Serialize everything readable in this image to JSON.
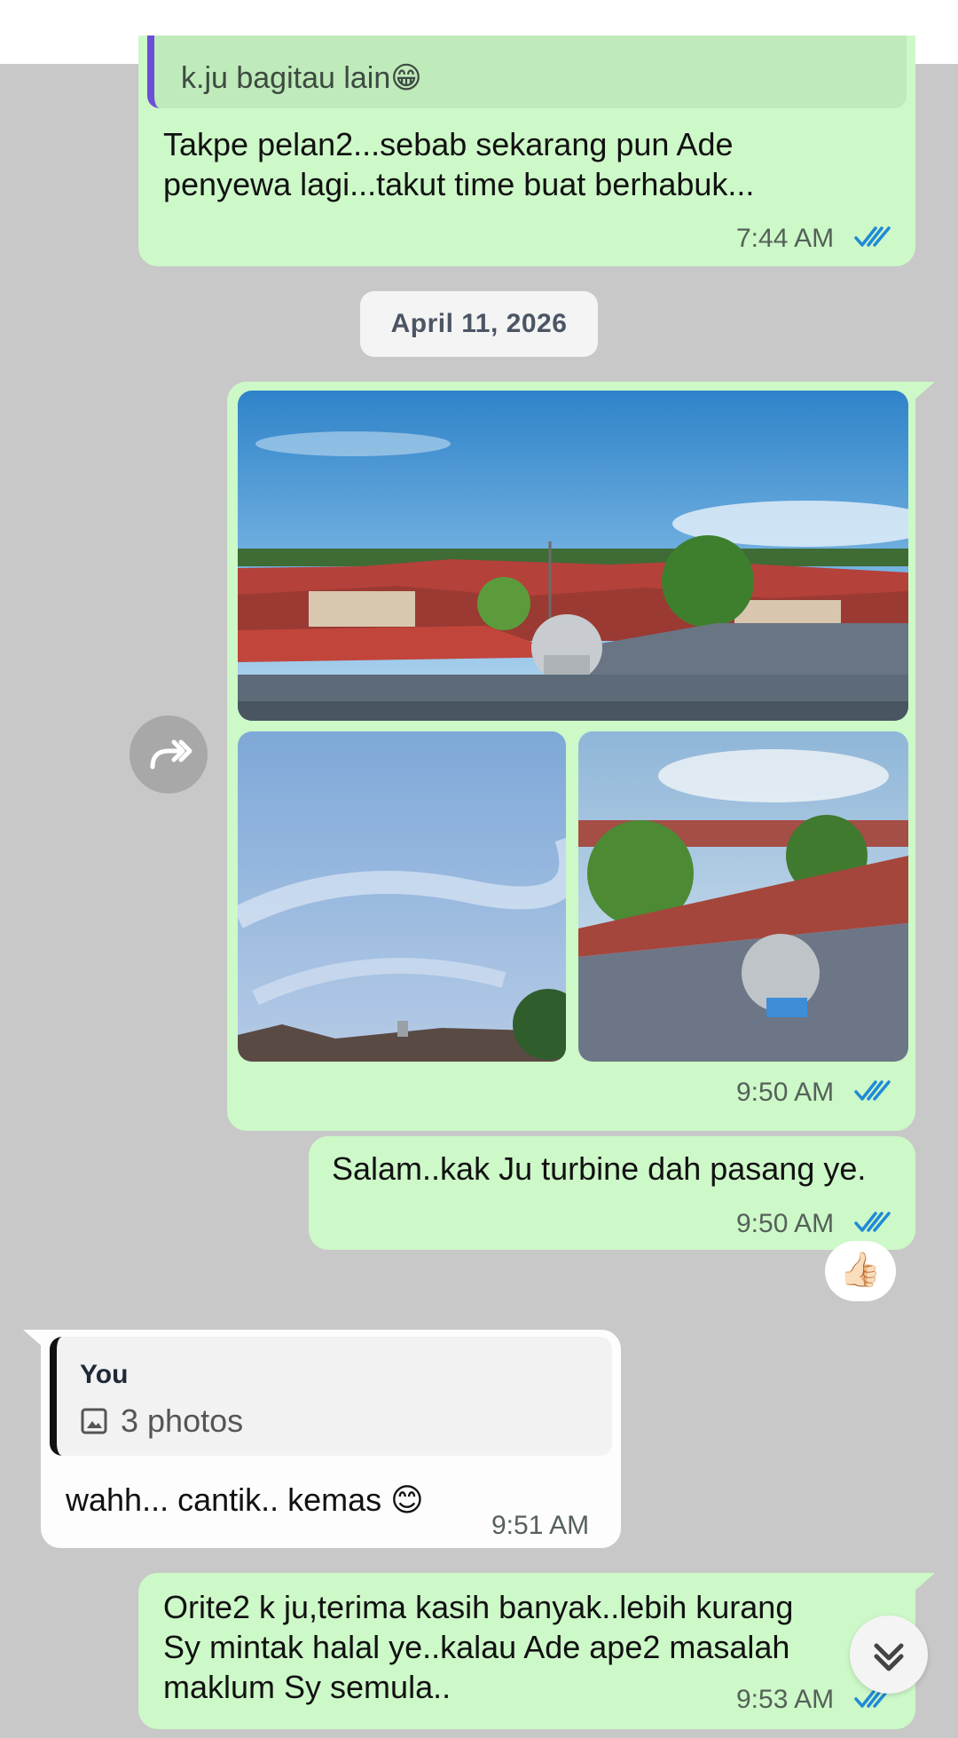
{
  "chat": {
    "messages": [
      {
        "quote_text": "k.ju bagitau lain😁",
        "lines": [
          "Takpe pelan2...sebab sekarang pun Ade",
          "penyewa lagi...takut time buat berhabuk..."
        ],
        "time": "7:44 AM"
      },
      {
        "type": "photo-album",
        "photo_count": 3,
        "time": "9:50 AM"
      },
      {
        "lines": [
          "Salam..kak Ju turbine dah pasang ye."
        ],
        "time": "9:50 AM",
        "reaction": "👍🏻"
      },
      {
        "quote_author": "You",
        "quote_preview": "3 photos",
        "lines": [
          "wahh... cantik.. kemas 😊"
        ],
        "time": "9:51 AM"
      },
      {
        "lines": [
          "Orite2 k ju,terima kasih banyak..lebih kurang",
          "Sy mintak halal ye..kalau Ade ape2 masalah",
          "maklum Sy semula.."
        ],
        "time": "9:53 AM"
      }
    ],
    "date_separator": "April 11, 2026"
  },
  "icons": {
    "forward": "forward-icon",
    "ticks": "double-check-icon",
    "gallery": "image-icon",
    "scroll_down": "chevron-double-down-icon"
  },
  "colors": {
    "outgoing_bubble": "#cdf8c8",
    "incoming_bubble": "#fdfdfd",
    "background": "#c8c8c8",
    "read_ticks": "#1f8ad6",
    "quote_bar": "#6a4fd6"
  }
}
